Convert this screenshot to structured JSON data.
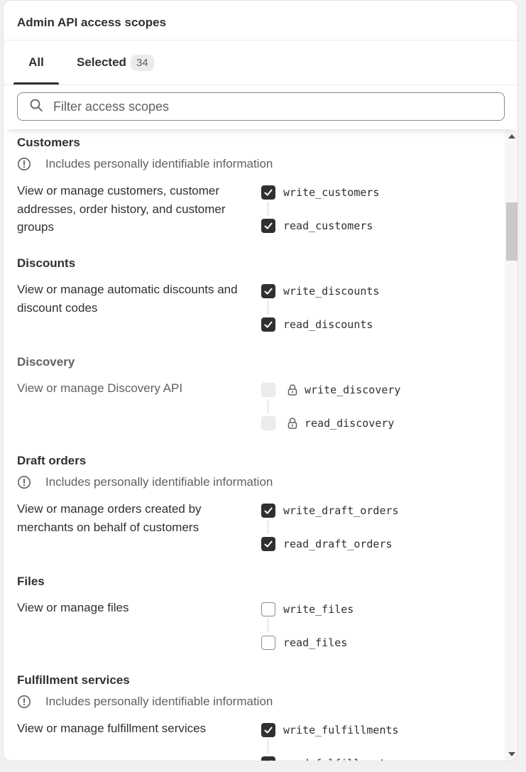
{
  "header": {
    "title": "Admin API access scopes"
  },
  "tabs": {
    "all_label": "All",
    "selected_label": "Selected",
    "selected_count": "34"
  },
  "filter": {
    "placeholder": "Filter access scopes"
  },
  "pii_notice": "Includes personally identifiable information",
  "sections": [
    {
      "title": "Customers",
      "pii": true,
      "description": "View or manage customers, customer addresses, order history, and customer groups",
      "write": {
        "name": "write_customers",
        "state": "checked"
      },
      "read": {
        "name": "read_customers",
        "state": "checked"
      }
    },
    {
      "title": "Discounts",
      "pii": false,
      "description": "View or manage automatic discounts and discount codes",
      "write": {
        "name": "write_discounts",
        "state": "checked"
      },
      "read": {
        "name": "read_discounts",
        "state": "checked"
      }
    },
    {
      "title": "Discovery",
      "pii": false,
      "description": "View or manage Discovery API",
      "write": {
        "name": "write_discovery",
        "state": "locked"
      },
      "read": {
        "name": "read_discovery",
        "state": "locked"
      }
    },
    {
      "title": "Draft orders",
      "pii": true,
      "description": "View or manage orders created by merchants on behalf of customers",
      "write": {
        "name": "write_draft_orders",
        "state": "checked"
      },
      "read": {
        "name": "read_draft_orders",
        "state": "checked"
      }
    },
    {
      "title": "Files",
      "pii": false,
      "description": "View or manage files",
      "write": {
        "name": "write_files",
        "state": "unchecked"
      },
      "read": {
        "name": "read_files",
        "state": "unchecked"
      }
    },
    {
      "title": "Fulfillment services",
      "pii": true,
      "description": "View or manage fulfillment services",
      "write": {
        "name": "write_fulfillments",
        "state": "checked"
      },
      "read": {
        "name": "read_fulfillments",
        "state": "checked"
      }
    }
  ],
  "icons": {
    "search": "search-icon",
    "info": "info-circle-icon",
    "lock": "lock-icon",
    "check": "checkmark-icon"
  },
  "colors": {
    "checkbox_checked": "#303030",
    "text_primary": "#303030",
    "text_secondary": "#616161",
    "border": "#8a8a8a"
  }
}
